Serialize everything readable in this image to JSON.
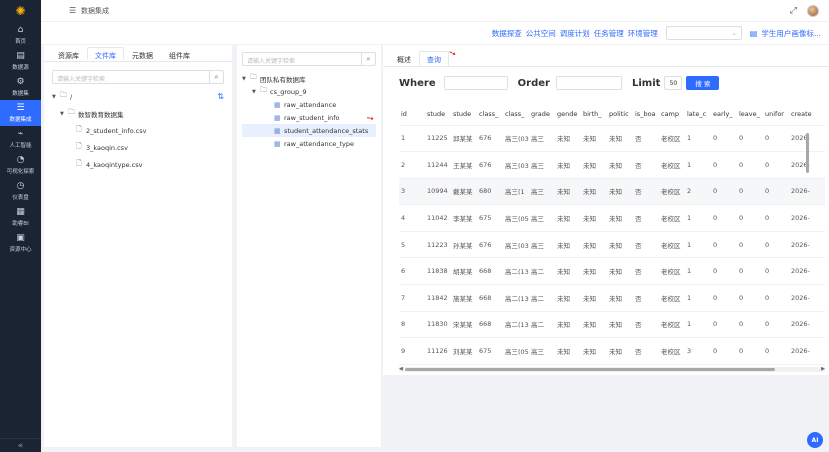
{
  "breadcrumb": "数据集成",
  "nav": {
    "items": [
      {
        "label": "首页",
        "icon": "home-icon",
        "glyph": "⌂"
      },
      {
        "label": "数据源",
        "icon": "database-icon",
        "glyph": "▤"
      },
      {
        "label": "数据集",
        "icon": "dataset-icon",
        "glyph": "⚙"
      },
      {
        "label": "数据集成",
        "icon": "integration-icon",
        "glyph": "☰"
      },
      {
        "label": "人工智能",
        "icon": "ai-icon",
        "glyph": "⌁"
      },
      {
        "label": "可视化探索",
        "icon": "chart-icon",
        "glyph": "◔"
      },
      {
        "label": "仪表盘",
        "icon": "dashboard-icon",
        "glyph": "◷"
      },
      {
        "label": "助睿BI",
        "icon": "bi-icon",
        "glyph": "▦"
      },
      {
        "label": "资源中心",
        "icon": "resource-icon",
        "glyph": "▣"
      }
    ]
  },
  "header_links": [
    "数据探查",
    "公共空间",
    "调度计划",
    "任务管理",
    "环境管理"
  ],
  "student_link": "学生用户画像标...",
  "left_panel": {
    "tabs": [
      "资源库",
      "文件库",
      "元数据",
      "组件库"
    ],
    "search_placeholder": "请输入关键字检索",
    "tree": {
      "root": "/",
      "folder": "数智教育数据集",
      "files": [
        "2_student_info.csv",
        "3_kaoqin.csv",
        "4_kaoqintype.csv"
      ]
    }
  },
  "mid_panel": {
    "search_placeholder": "请输入关键字检索",
    "root": "团队私有数据库",
    "group": "cs_group_9",
    "tables": [
      "raw_attendance",
      "raw_student_info",
      "student_attendance_stats",
      "raw_attendance_type"
    ]
  },
  "query_panel": {
    "tabs": [
      "概述",
      "查询"
    ],
    "where_label": "Where",
    "order_label": "Order",
    "limit_label": "Limit",
    "limit_value": "50",
    "search_button": "搜 索",
    "columns": [
      "id",
      "stude",
      "stude",
      "class_",
      "class_",
      "grade",
      "gende",
      "birth_",
      "politic",
      "is_boa",
      "camp",
      "late_c",
      "early_",
      "leave_",
      "unifor",
      "create"
    ],
    "rows": [
      [
        "1",
        "11225",
        "邱某某",
        "676",
        "高三(03)",
        "高三",
        "未知",
        "未知",
        "未知",
        "否",
        "老校区",
        "1",
        "0",
        "0",
        "0",
        "2026-"
      ],
      [
        "2",
        "11244",
        "王某某",
        "676",
        "高三(03)",
        "高三",
        "未知",
        "未知",
        "未知",
        "否",
        "老校区",
        "1",
        "0",
        "0",
        "0",
        "2026-"
      ],
      [
        "3",
        "10994",
        "戴某某",
        "680",
        "高三(1",
        "高三",
        "未知",
        "未知",
        "未知",
        "否",
        "老校区",
        "2",
        "0",
        "0",
        "0",
        "2026-"
      ],
      [
        "4",
        "11042",
        "李某某",
        "675",
        "高三(05)",
        "高三",
        "未知",
        "未知",
        "未知",
        "否",
        "老校区",
        "1",
        "0",
        "0",
        "0",
        "2026-"
      ],
      [
        "5",
        "11223",
        "孙某某",
        "676",
        "高三(03)",
        "高三",
        "未知",
        "未知",
        "未知",
        "否",
        "老校区",
        "1",
        "0",
        "0",
        "0",
        "2026-"
      ],
      [
        "6",
        "11838",
        "胡某某",
        "668",
        "高二(13)",
        "高二",
        "未知",
        "未知",
        "未知",
        "否",
        "老校区",
        "1",
        "0",
        "0",
        "0",
        "2026-"
      ],
      [
        "7",
        "11842",
        "施某某",
        "668",
        "高二(13)",
        "高二",
        "未知",
        "未知",
        "未知",
        "否",
        "老校区",
        "1",
        "0",
        "0",
        "0",
        "2026-"
      ],
      [
        "8",
        "11830",
        "宋某某",
        "668",
        "高二(13)",
        "高二",
        "未知",
        "未知",
        "未知",
        "否",
        "老校区",
        "1",
        "0",
        "0",
        "0",
        "2026-"
      ],
      [
        "9",
        "11126",
        "刘某某",
        "675",
        "高三(05)",
        "高三",
        "未知",
        "未知",
        "未知",
        "否",
        "老校区",
        "3",
        "0",
        "0",
        "0",
        "2026-"
      ]
    ]
  },
  "ai_badge": "AI"
}
